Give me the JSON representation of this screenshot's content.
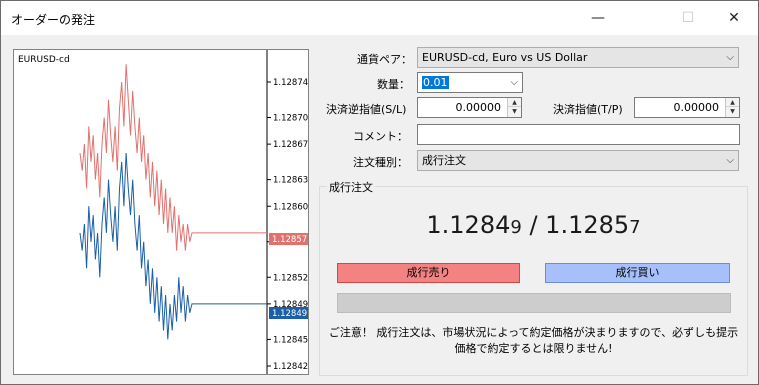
{
  "window": {
    "title": "オーダーの発注",
    "minimize_glyph": "—",
    "maximize_glyph": "☐",
    "close_glyph": "✕"
  },
  "chart": {
    "symbol": "EURUSD-cd",
    "price_ticks": [
      "1.12874",
      "1.12870",
      "1.12867",
      "1.12863",
      "1.12860",
      "1.12856",
      "1.12852",
      "1.12849",
      "1.12845",
      "1.12842"
    ],
    "ask_label": "1.12857",
    "bid_label": "1.12849",
    "ask_color": "#e0726e",
    "bid_color": "#1a5fa8",
    "ask_history": [
      1.12866,
      1.12864,
      1.12867,
      1.12862,
      1.12869,
      1.12865,
      1.12868,
      1.12863,
      1.12866,
      1.12861,
      1.12867,
      1.1287,
      1.12866,
      1.12872,
      1.12868,
      1.12865,
      1.12869,
      1.12864,
      1.12871,
      1.12874,
      1.12869,
      1.12876,
      1.12872,
      1.12868,
      1.12873,
      1.12869,
      1.12866,
      1.1287,
      1.12865,
      1.12868,
      1.12863,
      1.12866,
      1.12861,
      1.12865,
      1.1286,
      1.12864,
      1.12859,
      1.12863,
      1.12858,
      1.12862,
      1.12857,
      1.12861,
      1.12857,
      1.1286,
      1.12855,
      1.12859,
      1.12856,
      1.12858,
      1.12855,
      1.12858,
      1.12856,
      1.12857
    ],
    "bid_history": [
      1.12857,
      1.12855,
      1.12858,
      1.12853,
      1.1286,
      1.12856,
      1.12859,
      1.12854,
      1.12857,
      1.12852,
      1.12858,
      1.12861,
      1.12857,
      1.12863,
      1.12859,
      1.12856,
      1.1286,
      1.12855,
      1.12862,
      1.12865,
      1.1286,
      1.12866,
      1.12862,
      1.12859,
      1.12863,
      1.12858,
      1.12855,
      1.12859,
      1.12853,
      1.12856,
      1.12851,
      1.12854,
      1.12849,
      1.12853,
      1.12848,
      1.12852,
      1.12847,
      1.12851,
      1.12846,
      1.1285,
      1.12845,
      1.12849,
      1.12846,
      1.1285,
      1.12847,
      1.12852,
      1.12848,
      1.12851,
      1.12847,
      1.1285,
      1.12848,
      1.12849
    ]
  },
  "form": {
    "symbol_label": "通貨ペア：",
    "symbol_value": "EURUSD-cd, Euro vs US Dollar",
    "volume_label": "数量：",
    "volume_value": "0.01",
    "sl_label": "決済逆指値(S/L)",
    "sl_value": "0.00000",
    "tp_label": "決済指値(T/P)",
    "tp_value": "0.00000",
    "comment_label": "コメント：",
    "comment_value": "",
    "order_type_label": "注文種別：",
    "order_type_value": "成行注文"
  },
  "market": {
    "group_title": "成行注文",
    "bid_main": "1.1284",
    "bid_last": "9",
    "separator": " / ",
    "ask_main": "1.1285",
    "ask_last": "7",
    "sell_label": "成行売り",
    "buy_label": "成行買い",
    "note_line1": "ご注意！ 成行注文は、市場状況によって約定価格が決まりますので、必ずしも提示",
    "note_line2": "価格で約定するとは限りません!"
  }
}
